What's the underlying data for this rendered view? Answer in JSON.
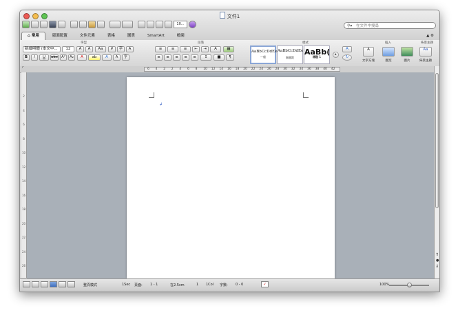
{
  "window": {
    "title": "文件1",
    "traffic_colors": [
      "#ec5b55",
      "#f4bd4f",
      "#5fc453"
    ]
  },
  "toolbar": {
    "zoom_value": "10..."
  },
  "search": {
    "placeholder": "在文件中搜尋"
  },
  "tabs": [
    {
      "label": "常用",
      "active": true
    },
    {
      "label": "版面配置"
    },
    {
      "label": "文件元素"
    },
    {
      "label": "表格"
    },
    {
      "label": "圖表"
    },
    {
      "label": "SmartArt"
    },
    {
      "label": "檢閱"
    }
  ],
  "ribbon": {
    "groups": {
      "font": "字型",
      "paragraph": "段落",
      "styles": "樣式",
      "insert": "插入",
      "themes": "佈景主題"
    },
    "font_name": "新細明體 (本文中...",
    "font_size": "12",
    "styles": [
      {
        "sample": "AaBbCcDdEe",
        "caption": "一般"
      },
      {
        "sample": "AaBbCcDdEe",
        "caption": "無間距"
      },
      {
        "sample": "AaBb(",
        "caption": "標題 1"
      }
    ],
    "insert_items": [
      {
        "label": "文字方塊"
      },
      {
        "label": "圖案"
      },
      {
        "label": "圖片"
      }
    ],
    "themes_label": "佈景主題"
  },
  "ruler": {
    "ticks": [
      "6",
      "4",
      "2",
      "2",
      "4",
      "6",
      "8",
      "10",
      "12",
      "14",
      "16",
      "18",
      "20",
      "22",
      "24",
      "26",
      "28",
      "30",
      "32",
      "34",
      "36",
      "38",
      "40",
      "42"
    ]
  },
  "vertical_ruler": {
    "ticks": [
      "2",
      "4",
      "6",
      "8",
      "10",
      "12",
      "14",
      "16",
      "18",
      "20",
      "22",
      "24",
      "26"
    ]
  },
  "status": {
    "view_mode": "整頁模式",
    "section": "1Sec",
    "pages_label": "頁面:",
    "pages_value": "1 - 1",
    "position": "在2.5cm",
    "line": "1",
    "col": "1Col",
    "words_label": "字數:",
    "words_value": "0 - 0",
    "zoom": "100%",
    "zoom_fraction": 0.5
  }
}
